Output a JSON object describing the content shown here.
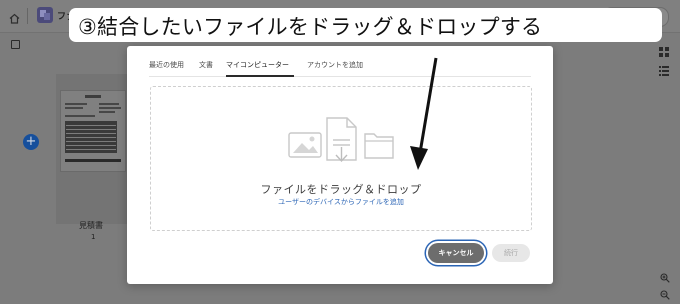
{
  "app": {
    "title": "ファ"
  },
  "icons": {
    "home": "home-icon",
    "app": "acrobat-icon",
    "select_all": "checkbox-icon",
    "grid_view": "grid-view-icon",
    "list_view": "list-view-icon",
    "zoom_in": "zoom-in-icon",
    "zoom_out": "zoom-out-icon",
    "add": "plus-icon",
    "drop_illustration": "files-illustration-icon"
  },
  "background_file": {
    "name": "見積書",
    "page": "1",
    "add_label": "+"
  },
  "dialog": {
    "tabs": [
      {
        "label": "最近の使用",
        "active": false
      },
      {
        "label": "文書",
        "active": false
      },
      {
        "label": "マイコンピューター",
        "active": true
      },
      {
        "label": "アカウントを追加",
        "active": false
      }
    ],
    "drop_title": "ファイルをドラッグ＆ドロップ",
    "drop_link": "ユーザーのデバイスからファイルを追加",
    "cancel_label": "キャンセル",
    "continue_label": "続行"
  },
  "annotation": {
    "text": "③結合したいファイルをドラッグ＆ドロップする"
  },
  "colors": {
    "overlay": "#7c7c7c",
    "link": "#2a64b5",
    "cancel_bg": "#6d6d6d",
    "add_button": "#164f9c"
  }
}
